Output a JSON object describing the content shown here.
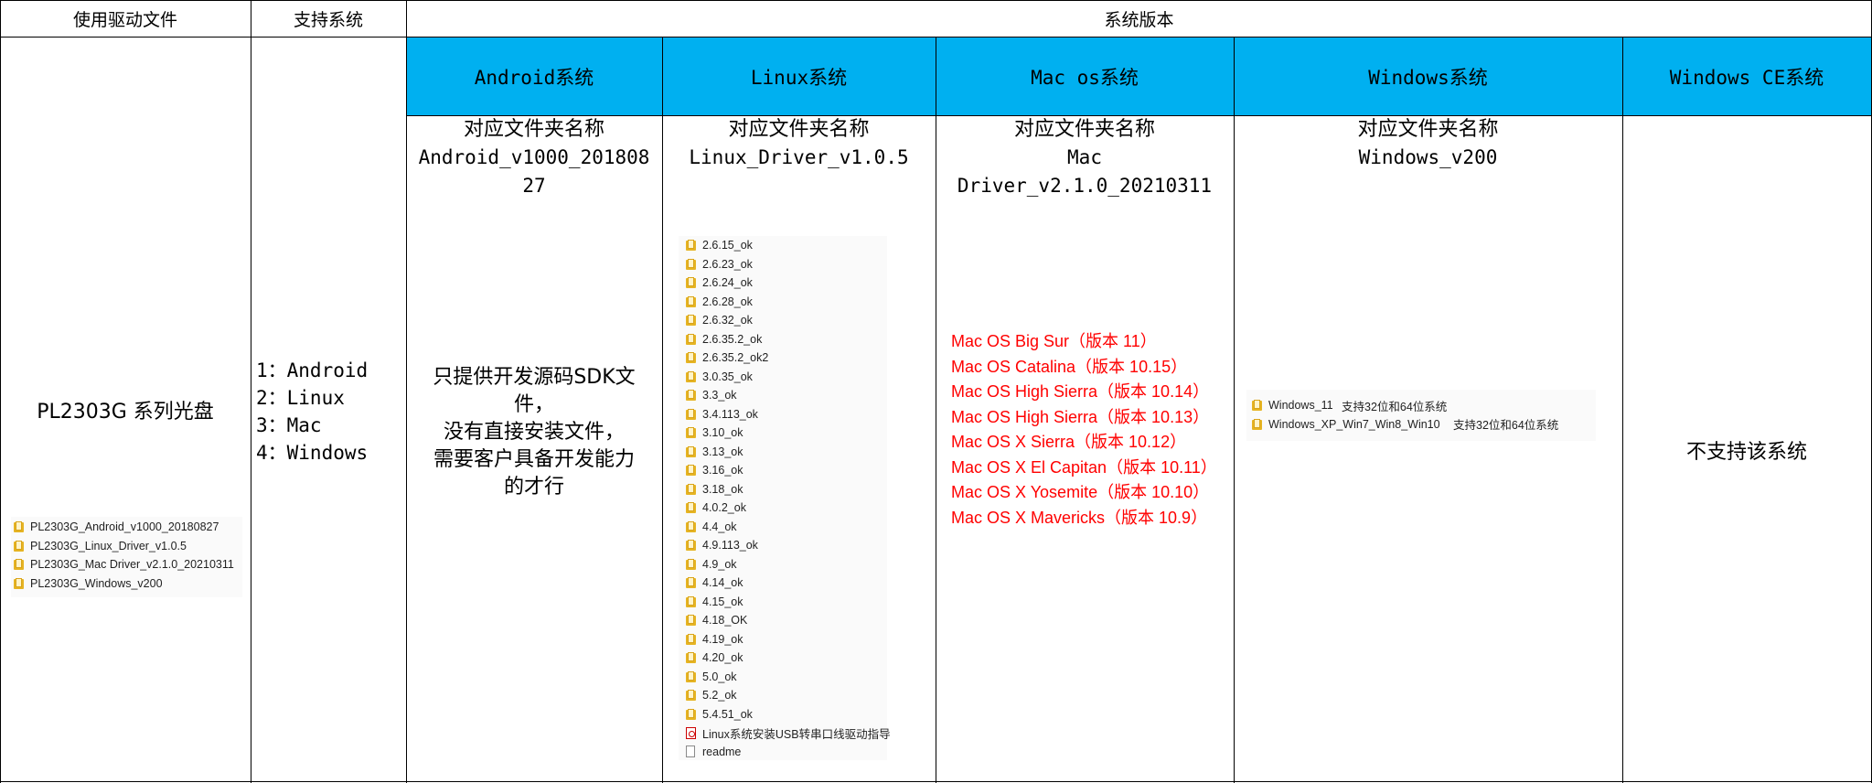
{
  "headers": {
    "driver_file": "使用驱动文件",
    "supported_systems": "支持系统",
    "system_version": "系统版本"
  },
  "os_columns": [
    "Android系统",
    "Linux系统",
    "Mac os系统",
    "Windows系统",
    "Windows CE系统"
  ],
  "driver": {
    "title": "PL2303G 系列光盘",
    "folders": [
      "PL2303G_Android_v1000_20180827",
      "PL2303G_Linux_Driver_v1.0.5",
      "PL2303G_Mac Driver_v2.1.0_20210311",
      "PL2303G_Windows_v200"
    ]
  },
  "supported": [
    "1：Android",
    "2：Linux",
    "3：Mac",
    "4：Windows"
  ],
  "android": {
    "folder_label": "对应文件夹名称",
    "folder_name_1": "Android_v1000_201808",
    "folder_name_2": "27",
    "note_1": "只提供开发源码SDK文",
    "note_2": "件，",
    "note_3": "没有直接安装文件，",
    "note_4": "需要客户具备开发能力",
    "note_5": "的才行"
  },
  "linux": {
    "folder_label": "对应文件夹名称",
    "folder_name": "Linux_Driver_v1.0.5",
    "folders": [
      "2.6.15_ok",
      "2.6.23_ok",
      "2.6.24_ok",
      "2.6.28_ok",
      "2.6.32_ok",
      "2.6.35.2_ok",
      "2.6.35.2_ok2",
      "3.0.35_ok",
      "3.3_ok",
      "3.4.113_ok",
      "3.10_ok",
      "3.13_ok",
      "3.16_ok",
      "3.18_ok",
      "4.0.2_ok",
      "4.4_ok",
      "4.9.113_ok",
      "4.9_ok",
      "4.14_ok",
      "4.15_ok",
      "4.18_OK",
      "4.19_ok",
      "4.20_ok",
      "5.0_ok",
      "5.2_ok",
      "5.4.51_ok"
    ],
    "pdf_file": "Linux系统安装USB转串口线驱动指导",
    "readme_file": "readme"
  },
  "mac": {
    "folder_label": "对应文件夹名称",
    "folder_name_1": "Mac",
    "folder_name_2": "Driver_v2.1.0_20210311",
    "versions": [
      "Mac OS Big Sur（版本 11）",
      "Mac OS Catalina（版本 10.15）",
      "Mac OS High Sierra（版本 10.14）",
      "Mac OS High Sierra（版本 10.13）",
      "Mac OS X Sierra（版本 10.12）",
      "Mac OS X El Capitan（版本 10.11）",
      "Mac OS X Yosemite（版本 10.10）",
      "Mac OS X Mavericks（版本 10.9）"
    ],
    "text_color": "#ff0000"
  },
  "windows": {
    "folder_label": "对应文件夹名称",
    "folder_name": "Windows_v200",
    "folders": [
      {
        "name": "Windows_11",
        "note": "支持32位和64位系统"
      },
      {
        "name": "Windows_XP_Win7_Win8_Win10",
        "note": "支持32位和64位系统"
      }
    ]
  },
  "wince": {
    "note": "不支持该系统"
  },
  "colors": {
    "header_blue": "#00b0f0",
    "folder_yellow": "#e6b422"
  }
}
